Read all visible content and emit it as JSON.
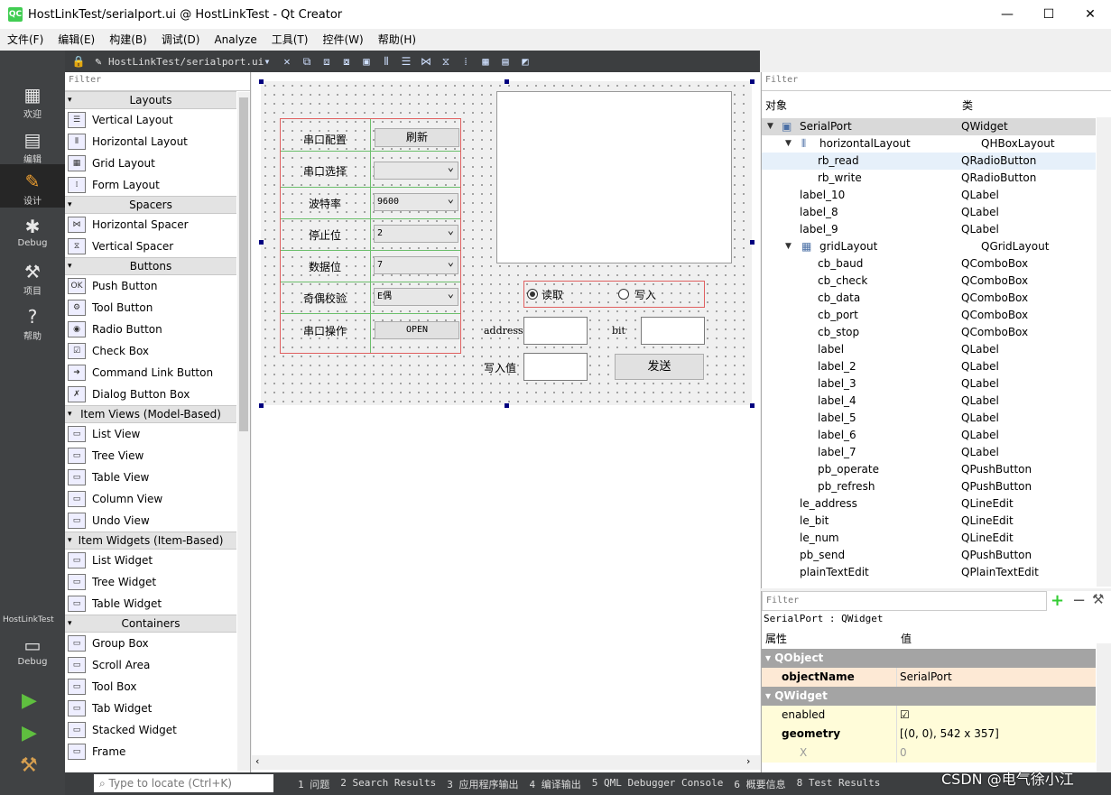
{
  "window": {
    "title": "HostLinkTest/serialport.ui @ HostLinkTest - Qt Creator",
    "app_icon": "QC"
  },
  "menu": [
    "文件(F)",
    "编辑(E)",
    "构建(B)",
    "调试(D)",
    "Analyze",
    "工具(T)",
    "控件(W)",
    "帮助(H)"
  ],
  "modes": [
    {
      "label": "欢迎",
      "icon": "grid-icon"
    },
    {
      "label": "编辑",
      "icon": "document-icon"
    },
    {
      "label": "设计",
      "icon": "pencil-icon"
    },
    {
      "label": "Debug",
      "icon": "bug-icon"
    },
    {
      "label": "项目",
      "icon": "wrench-icon"
    },
    {
      "label": "帮助",
      "icon": "help-icon"
    }
  ],
  "project_selector": {
    "project": "HostLinkTest",
    "config": "Debug"
  },
  "editor_toolbar": {
    "file": "HostLinkTest/serialport.ui"
  },
  "widget_box": {
    "filter_placeholder": "Filter",
    "categories": [
      {
        "name": "Layouts",
        "items": [
          "Vertical Layout",
          "Horizontal Layout",
          "Grid Layout",
          "Form Layout"
        ]
      },
      {
        "name": "Spacers",
        "items": [
          "Horizontal Spacer",
          "Vertical Spacer"
        ]
      },
      {
        "name": "Buttons",
        "items": [
          "Push Button",
          "Tool Button",
          "Radio Button",
          "Check Box",
          "Command Link Button",
          "Dialog Button Box"
        ]
      },
      {
        "name": "Item Views (Model-Based)",
        "items": [
          "List View",
          "Tree View",
          "Table View",
          "Column View",
          "Undo View"
        ]
      },
      {
        "name": "Item Widgets (Item-Based)",
        "items": [
          "List Widget",
          "Tree Widget",
          "Table Widget"
        ]
      },
      {
        "name": "Containers",
        "items": [
          "Group Box",
          "Scroll Area",
          "Tool Box",
          "Tab Widget",
          "Stacked Widget",
          "Frame"
        ]
      }
    ]
  },
  "form": {
    "grid_labels": [
      "串口配置",
      "串口选择",
      "波特率",
      "停止位",
      "数据位",
      "奇偶校验",
      "串口操作"
    ],
    "refresh_button": "刷新",
    "combos": {
      "port": "",
      "baud": "9600",
      "stop": "2",
      "data": "7",
      "parity": "E偶"
    },
    "open_button": "OPEN",
    "radio_read": "读取",
    "radio_write": "写入",
    "radio_read_checked": true,
    "address_label": "address",
    "bit_label": "bit",
    "write_value_label": "写入值",
    "send_button": "发送"
  },
  "object_inspector": {
    "filter_placeholder": "Filter",
    "header_object": "对象",
    "header_class": "类",
    "rows": [
      {
        "name": "SerialPort",
        "cls": "QWidget",
        "level": 0,
        "expanded": true
      },
      {
        "name": "horizontalLayout",
        "cls": "QHBoxLayout",
        "level": 1,
        "expanded": true
      },
      {
        "name": "rb_read",
        "cls": "QRadioButton",
        "level": 2
      },
      {
        "name": "rb_write",
        "cls": "QRadioButton",
        "level": 2
      },
      {
        "name": "label_10",
        "cls": "QLabel",
        "level": 1
      },
      {
        "name": "label_8",
        "cls": "QLabel",
        "level": 1
      },
      {
        "name": "label_9",
        "cls": "QLabel",
        "level": 1
      },
      {
        "name": "gridLayout",
        "cls": "QGridLayout",
        "level": 1,
        "expanded": true
      },
      {
        "name": "cb_baud",
        "cls": "QComboBox",
        "level": 2
      },
      {
        "name": "cb_check",
        "cls": "QComboBox",
        "level": 2
      },
      {
        "name": "cb_data",
        "cls": "QComboBox",
        "level": 2
      },
      {
        "name": "cb_port",
        "cls": "QComboBox",
        "level": 2
      },
      {
        "name": "cb_stop",
        "cls": "QComboBox",
        "level": 2
      },
      {
        "name": "label",
        "cls": "QLabel",
        "level": 2
      },
      {
        "name": "label_2",
        "cls": "QLabel",
        "level": 2
      },
      {
        "name": "label_3",
        "cls": "QLabel",
        "level": 2
      },
      {
        "name": "label_4",
        "cls": "QLabel",
        "level": 2
      },
      {
        "name": "label_5",
        "cls": "QLabel",
        "level": 2
      },
      {
        "name": "label_6",
        "cls": "QLabel",
        "level": 2
      },
      {
        "name": "label_7",
        "cls": "QLabel",
        "level": 2
      },
      {
        "name": "pb_operate",
        "cls": "QPushButton",
        "level": 2
      },
      {
        "name": "pb_refresh",
        "cls": "QPushButton",
        "level": 2
      },
      {
        "name": "le_address",
        "cls": "QLineEdit",
        "level": 1
      },
      {
        "name": "le_bit",
        "cls": "QLineEdit",
        "level": 1
      },
      {
        "name": "le_num",
        "cls": "QLineEdit",
        "level": 1
      },
      {
        "name": "pb_send",
        "cls": "QPushButton",
        "level": 1
      },
      {
        "name": "plainTextEdit",
        "cls": "QPlainTextEdit",
        "level": 1
      }
    ]
  },
  "property_editor": {
    "filter_placeholder": "Filter",
    "context": "SerialPort : QWidget",
    "header_property": "属性",
    "header_value": "值",
    "rows": [
      {
        "kind": "group",
        "name": "QObject"
      },
      {
        "kind": "prop",
        "name": "objectName",
        "value": "SerialPort",
        "bold": true
      },
      {
        "kind": "group",
        "name": "QWidget"
      },
      {
        "kind": "prop",
        "name": "enabled",
        "value": "☑"
      },
      {
        "kind": "prop",
        "name": "geometry",
        "value": "[(0, 0), 542 x 357]",
        "bold": true
      },
      {
        "kind": "prop",
        "name": "X",
        "value": "0",
        "sub": true
      }
    ]
  },
  "status_bar": {
    "locate_placeholder": "Type to locate (Ctrl+K)",
    "tabs": [
      "1  问题",
      "2  Search Results",
      "3  应用程序输出",
      "4  编译输出",
      "5  QML Debugger Console",
      "6  概要信息",
      "8  Test Results"
    ]
  },
  "watermark": "CSDN @电气徐小江"
}
